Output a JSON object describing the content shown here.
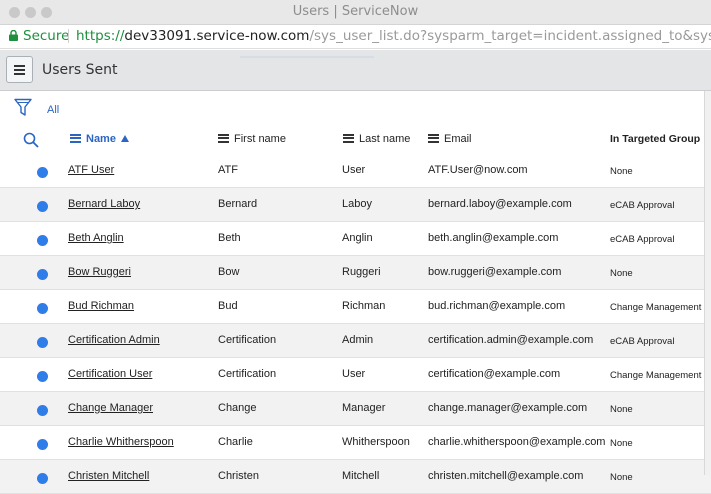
{
  "window": {
    "title": "Users | ServiceNow"
  },
  "address_bar": {
    "secure_label": "Secure",
    "url_scheme": "https://",
    "url_host": "dev33091.service-now.com",
    "url_path": "/sys_user_list.do?sysparm_target=incident.assigned_to&sysparm_target_..."
  },
  "header": {
    "list_title": "Users Sent"
  },
  "filter": {
    "all_label": "All"
  },
  "columns": {
    "name": "Name",
    "first_name": "First name",
    "last_name": "Last name",
    "email": "Email",
    "group": "In Targeted Group"
  },
  "icons": {
    "menu": "hamburger-menu-icon",
    "filter": "funnel-icon",
    "search": "magnifier-icon",
    "sort": "sort-ascending-icon",
    "row_status": "blue-dot-icon",
    "lock": "lock-icon"
  },
  "colors": {
    "accent_blue": "#2a65c4",
    "status_dot": "#2e7de9",
    "secure_green": "#1e8f3e",
    "header_bg": "#e3e5e7"
  },
  "rows": [
    {
      "name": "ATF User",
      "first_name": "ATF",
      "last_name": "User",
      "email": "ATF.User@now.com",
      "group": "None"
    },
    {
      "name": "Bernard Laboy",
      "first_name": "Bernard",
      "last_name": "Laboy",
      "email": "bernard.laboy@example.com",
      "group": "eCAB Approval"
    },
    {
      "name": "Beth Anglin",
      "first_name": "Beth",
      "last_name": "Anglin",
      "email": "beth.anglin@example.com",
      "group": "eCAB Approval"
    },
    {
      "name": "Bow Ruggeri",
      "first_name": "Bow",
      "last_name": "Ruggeri",
      "email": "bow.ruggeri@example.com",
      "group": "None"
    },
    {
      "name": "Bud Richman",
      "first_name": "Bud",
      "last_name": "Richman",
      "email": "bud.richman@example.com",
      "group": "Change Management"
    },
    {
      "name": "Certification Admin",
      "first_name": "Certification",
      "last_name": "Admin",
      "email": "certification.admin@example.com",
      "group": "eCAB Approval"
    },
    {
      "name": "Certification User",
      "first_name": "Certification",
      "last_name": "User",
      "email": "certification@example.com",
      "group": "Change Management"
    },
    {
      "name": "Change Manager",
      "first_name": "Change",
      "last_name": "Manager",
      "email": "change.manager@example.com",
      "group": "None"
    },
    {
      "name": "Charlie Whitherspoon",
      "first_name": "Charlie",
      "last_name": "Whitherspoon",
      "email": "charlie.whitherspoon@example.com",
      "group": "None"
    },
    {
      "name": "Christen Mitchell",
      "first_name": "Christen",
      "last_name": "Mitchell",
      "email": "christen.mitchell@example.com",
      "group": "None"
    }
  ]
}
